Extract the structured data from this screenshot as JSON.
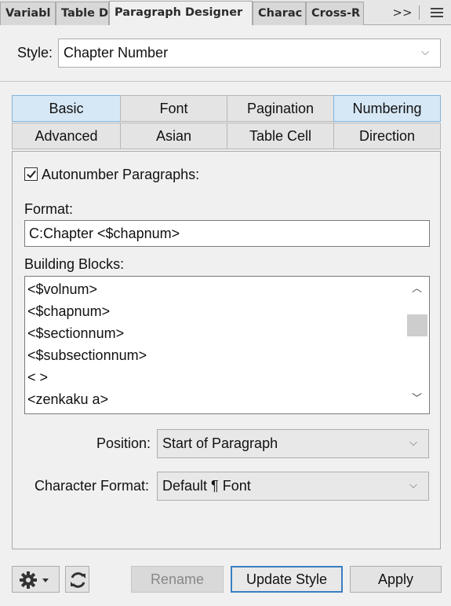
{
  "panel_tabs": [
    {
      "label": "Variabl"
    },
    {
      "label": "Table D"
    },
    {
      "label": "Paragraph Designer"
    },
    {
      "label": "Charac"
    },
    {
      "label": "Cross-R"
    }
  ],
  "overflow_label": ">>",
  "style_row": {
    "label": "Style:",
    "value": "Chapter Number"
  },
  "subtabs": [
    {
      "label": "Basic"
    },
    {
      "label": "Font"
    },
    {
      "label": "Pagination"
    },
    {
      "label": "Numbering"
    },
    {
      "label": "Advanced"
    },
    {
      "label": "Asian"
    },
    {
      "label": "Table Cell"
    },
    {
      "label": "Direction"
    }
  ],
  "numbering": {
    "autonumber_label": "Autonumber Paragraphs:",
    "autonumber_checked": true,
    "format_label": "Format:",
    "format_value": "C:Chapter <$chapnum>",
    "building_blocks_label": "Building Blocks:",
    "building_blocks": [
      "<$volnum>",
      "<$chapnum>",
      "<$sectionnum>",
      "<$subsectionnum>",
      "< >",
      "<zenkaku a>"
    ],
    "position_label": "Position:",
    "position_value": "Start of Paragraph",
    "char_format_label": "Character Format:",
    "char_format_value": "Default ¶ Font"
  },
  "bottom": {
    "rename_label": "Rename",
    "update_label": "Update Style",
    "apply_label": "Apply"
  },
  "icons": {
    "settings": "gear-icon",
    "refresh": "refresh-icon",
    "menu": "hamburger-menu-icon"
  },
  "colors": {
    "selected_tab": "#d6e8f6",
    "focus_border": "#3a7fc1"
  }
}
